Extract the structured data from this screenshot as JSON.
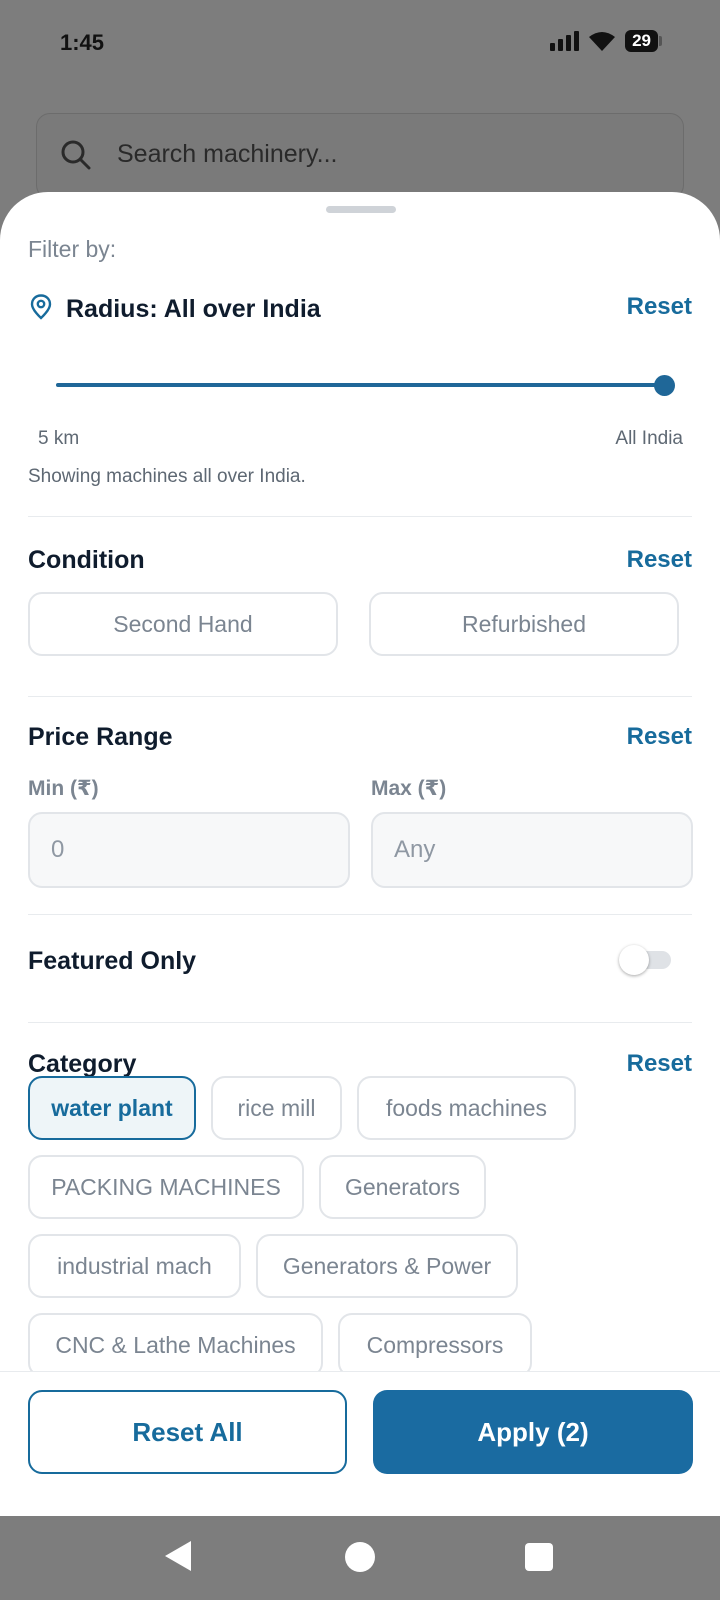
{
  "status_bar": {
    "time": "1:45",
    "battery": "29",
    "icons": [
      "signal-icon",
      "wifi-icon",
      "battery-icon"
    ]
  },
  "background": {
    "search_placeholder": "Search machinery..."
  },
  "filter": {
    "heading": "Filter by:",
    "radius": {
      "title": "Radius: All over India",
      "reset": "Reset",
      "min_label": "5 km",
      "max_label": "All India",
      "value_fraction": 1.0,
      "description": "Showing machines all over India."
    },
    "condition": {
      "title": "Condition",
      "reset": "Reset",
      "options": [
        "Second Hand",
        "Refurbished"
      ]
    },
    "price": {
      "title": "Price Range",
      "reset": "Reset",
      "min_label": "Min (₹)",
      "max_label": "Max (₹)",
      "min_value": "0",
      "max_placeholder": "Any"
    },
    "featured": {
      "title": "Featured Only",
      "enabled": false
    },
    "category": {
      "title": "Category",
      "reset": "Reset",
      "chips": [
        "water plant",
        "rice mill",
        "foods machines",
        "PACKING MACHINES",
        "Generators",
        "industrial mach",
        "Generators & Power",
        "CNC & Lathe Machines",
        "Compressors"
      ],
      "selected": "water plant"
    }
  },
  "footer": {
    "reset_all": "Reset All",
    "apply": "Apply (2)"
  },
  "colors": {
    "accent": "#176b9c",
    "apply_bg": "#1a6ba1"
  }
}
